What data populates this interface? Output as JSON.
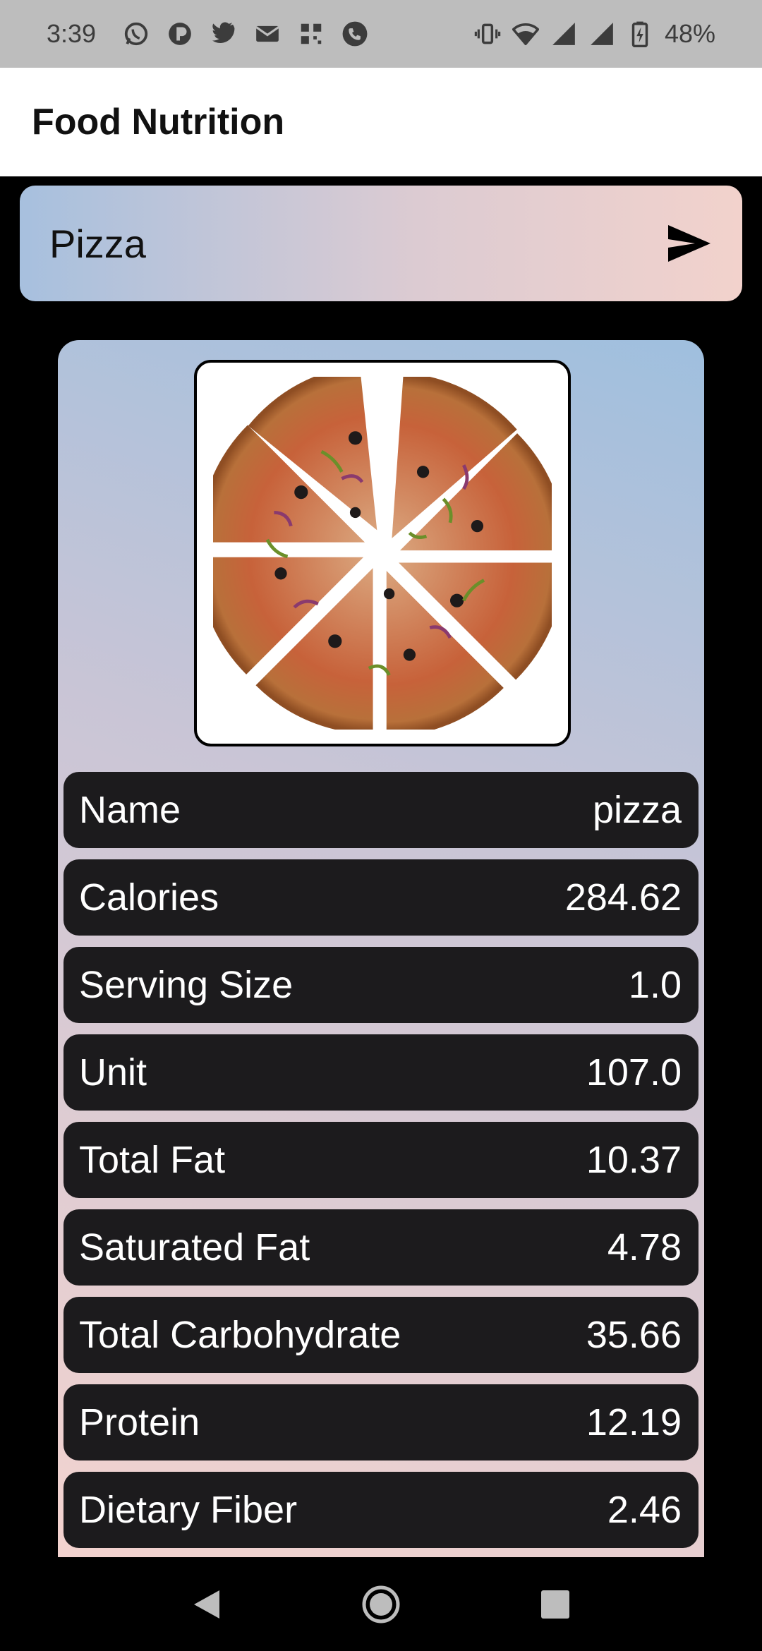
{
  "status_bar": {
    "time": "3:39",
    "battery": "48%",
    "left_icons": [
      "whatsapp-icon",
      "app-icon",
      "twitter-icon",
      "mail-icon",
      "qr-icon",
      "phone-icon"
    ],
    "right_icons": [
      "vibrate-icon",
      "wifi-icon",
      "signal-icon",
      "signal-icon",
      "battery-charging-icon"
    ]
  },
  "app_bar": {
    "title": "Food Nutrition"
  },
  "search": {
    "value": "Pizza",
    "send_icon": "send-icon"
  },
  "nutrition": [
    {
      "label": "Name",
      "value": "pizza"
    },
    {
      "label": "Calories",
      "value": "284.62"
    },
    {
      "label": "Serving Size",
      "value": "1.0"
    },
    {
      "label": "Unit",
      "value": "107.0"
    },
    {
      "label": "Total Fat",
      "value": "10.37"
    },
    {
      "label": "Saturated Fat",
      "value": "4.78"
    },
    {
      "label": "Total Carbohydrate",
      "value": "35.66"
    },
    {
      "label": "Protein",
      "value": "12.19"
    },
    {
      "label": "Dietary Fiber",
      "value": "2.46"
    }
  ],
  "nav_bar": {
    "icons": [
      "back-icon",
      "home-icon",
      "recents-icon"
    ]
  },
  "colors": {
    "row_bg": "#1c1b1d",
    "card_top": "#9fbfde",
    "card_bottom": "#f3d3cf",
    "status_bar_bg": "#bdbdbd"
  }
}
